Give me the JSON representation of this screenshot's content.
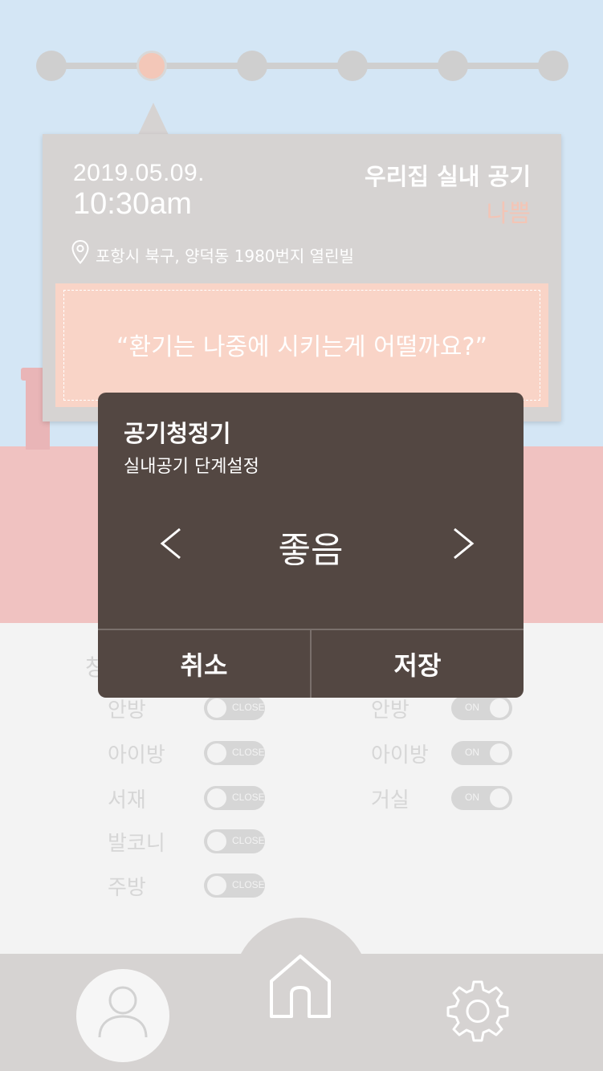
{
  "timeline": {
    "step_count": 6,
    "active_index": 1
  },
  "card": {
    "date": "2019.05.09.",
    "time": "10:30am",
    "air_title": "우리집 실내 공기",
    "air_status": "나쁨",
    "address": "포항시 북구, 양덕동 1980번지 열린빌",
    "message": "“환기는 나중에 시키는게 어떨까요?”"
  },
  "background_list": {
    "left_col_title": "창",
    "left_rooms": [
      {
        "label": "안방",
        "state": "CLOSE"
      },
      {
        "label": "아이방",
        "state": "CLOSE"
      },
      {
        "label": "서재",
        "state": "CLOSE"
      },
      {
        "label": "발코니",
        "state": "CLOSE"
      },
      {
        "label": "주방",
        "state": "CLOSE"
      }
    ],
    "right_rooms": [
      {
        "label": "안방",
        "state": "ON"
      },
      {
        "label": "아이방",
        "state": "ON"
      },
      {
        "label": "거실",
        "state": "ON"
      }
    ]
  },
  "modal": {
    "title": "공기청정기",
    "subtitle": "실내공기 단계설정",
    "level": "좋음",
    "prev_icon": "chevron-left-icon",
    "next_icon": "chevron-right-icon",
    "cancel_label": "취소",
    "save_label": "저장"
  },
  "nav": {
    "left_icon": "user-icon",
    "center_icon": "home-icon",
    "right_icon": "gear-icon"
  },
  "colors": {
    "sky": "#d4e6f5",
    "pink": "#f0c2c1",
    "card": "#d6d3d2",
    "accent_peach": "#f3c5b6",
    "modal_bg": "#534742"
  }
}
